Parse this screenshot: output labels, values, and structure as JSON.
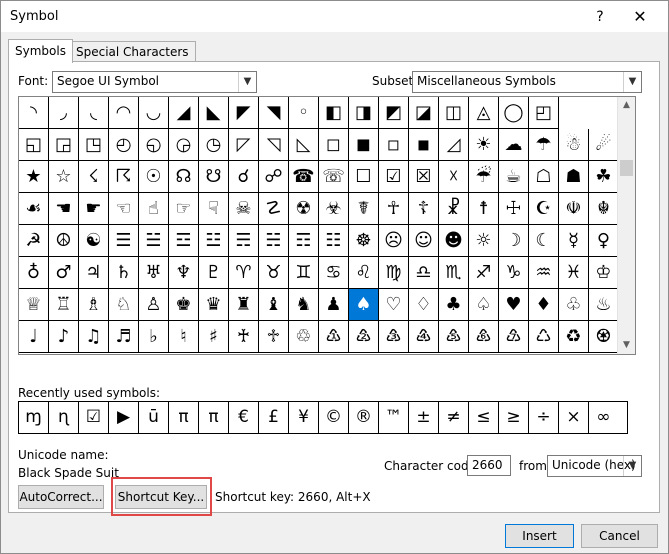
{
  "window": {
    "title": "Symbol",
    "help": "?",
    "close": "✕"
  },
  "tabs": [
    "Symbols",
    "Special Characters"
  ],
  "font": {
    "label": "Font:",
    "value": "Segoe UI Symbol"
  },
  "subset": {
    "label": "Subset:",
    "value": "Miscellaneous Symbols"
  },
  "grid": [
    [
      "◝",
      "◞",
      "◟",
      "◠",
      "◡",
      "◢",
      "◣",
      "◤",
      "◥",
      "◦",
      "◧",
      "◨",
      "◩",
      "◪",
      "◫",
      "◬",
      "◯",
      "◰"
    ],
    [
      "◱",
      "◲",
      "◳",
      "◴",
      "◵",
      "◶",
      "◷",
      "◸",
      "◹",
      "◺",
      "◻",
      "◼",
      "◽",
      "◾",
      "◿",
      "☀",
      "☁",
      "☂",
      "☃",
      "☄"
    ],
    [
      "★",
      "☆",
      "☇",
      "☈",
      "☉",
      "☊",
      "☋",
      "☌",
      "☍",
      "☎",
      "☏",
      "☐",
      "☑",
      "☒",
      "☓",
      "☔",
      "☕",
      "☖",
      "☗",
      "☘"
    ],
    [
      "☙",
      "☚",
      "☛",
      "☜",
      "☝",
      "☞",
      "☟",
      "☠",
      "☡",
      "☢",
      "☣",
      "☤",
      "☥",
      "☦",
      "☧",
      "☨",
      "☩",
      "☪",
      "☫",
      "☬"
    ],
    [
      "☭",
      "☮",
      "☯",
      "☰",
      "☱",
      "☲",
      "☳",
      "☴",
      "☵",
      "☶",
      "☷",
      "☸",
      "☹",
      "☺",
      "☻",
      "☼",
      "☽",
      "☾",
      "☿",
      "♀"
    ],
    [
      "♁",
      "♂",
      "♃",
      "♄",
      "♅",
      "♆",
      "♇",
      "♈",
      "♉",
      "♊",
      "♋",
      "♌",
      "♍",
      "♎",
      "♏",
      "♐",
      "♑",
      "♒",
      "♓",
      "♔"
    ],
    [
      "♕",
      "♖",
      "♗",
      "♘",
      "♙",
      "♚",
      "♛",
      "♜",
      "♝",
      "♞",
      "♟",
      "♠",
      "♡",
      "♢",
      "♣",
      "♤",
      "♥",
      "♦",
      "♧",
      "♨"
    ],
    [
      "♩",
      "♪",
      "♫",
      "♬",
      "♭",
      "♮",
      "♯",
      "♰",
      "♱",
      "♲",
      "♳",
      "♴",
      "♵",
      "♶",
      "♷",
      "♸",
      "♹",
      "♺",
      "♻",
      "♼"
    ]
  ],
  "selected_symbol": "♠",
  "recent": {
    "label": "Recently used symbols:",
    "items": [
      "ɱ",
      "ɳ",
      "☑",
      "▶",
      "ū",
      "π",
      "π",
      "€",
      "£",
      "¥",
      "©",
      "®",
      "™",
      "±",
      "≠",
      "≤",
      "≥",
      "÷",
      "×",
      "∞"
    ]
  },
  "unicode_name": {
    "label": "Unicode name:",
    "value": "Black Spade Suit"
  },
  "char_code": {
    "label": "Character code:",
    "value": "2660",
    "from_label": "from:",
    "from_value": "Unicode (hex)"
  },
  "buttons": {
    "autocorrect": "AutoCorrect...",
    "shortcut_key": "Shortcut Key...",
    "insert": "Insert",
    "cancel": "Cancel"
  },
  "shortcut_info": "Shortcut key: 2660, Alt+X",
  "colors": {
    "selection": "#0078d7",
    "highlight": "#e04848"
  }
}
